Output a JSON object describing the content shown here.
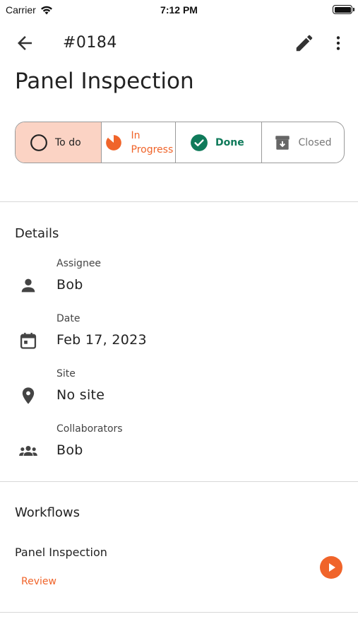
{
  "status_bar": {
    "carrier": "Carrier",
    "time": "7:12 PM"
  },
  "header": {
    "task_id": "#0184",
    "back_icon": "arrow-left-icon",
    "edit_icon": "pencil-icon",
    "more_icon": "more-vertical-icon"
  },
  "title": "Panel Inspection",
  "status_options": [
    {
      "label": "To do",
      "icon": "circle-outline-icon",
      "selected": true
    },
    {
      "label_line1": "In",
      "label_line2": "Progress",
      "icon": "pie-progress-icon"
    },
    {
      "label": "Done",
      "icon": "check-circle-icon"
    },
    {
      "label": "Closed",
      "icon": "archive-icon"
    }
  ],
  "details": {
    "section_title": "Details",
    "assignee": {
      "label": "Assignee",
      "value": "Bob",
      "icon": "person-icon"
    },
    "date": {
      "label": "Date",
      "value": "Feb 17, 2023",
      "icon": "calendar-icon"
    },
    "site": {
      "label": "Site",
      "value": "No site",
      "icon": "location-pin-icon"
    },
    "collaborators": {
      "label": "Collaborators",
      "value": "Bob",
      "icon": "group-icon"
    }
  },
  "workflows": {
    "section_title": "Workflows",
    "items": [
      {
        "name": "Panel Inspection",
        "status": "Review",
        "action_icon": "play-icon"
      }
    ]
  },
  "colors": {
    "accent": "#f0642a",
    "selected_bg": "#fbd3c4",
    "done": "#0f7a5a",
    "closed": "#777777"
  }
}
